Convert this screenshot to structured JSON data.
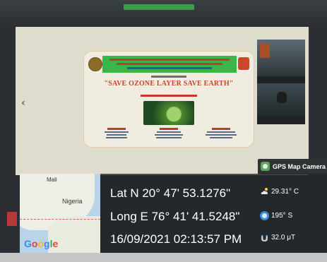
{
  "slide": {
    "title": "\"SAVE OZONE LAYER SAVE EARTH\""
  },
  "nav": {
    "prev_arrow": "‹"
  },
  "gps_badge": {
    "label": "GPS Map Camera"
  },
  "map": {
    "labels": [
      "Mali",
      "Nigeria"
    ],
    "logo": "Google"
  },
  "readout": {
    "latitude": "Lat N 20° 47' 53.1276\"",
    "longitude": "Long E 76° 41' 41.5248\"",
    "datetime": "16/09/2021 02:13:57 PM",
    "temperature": "29.31° C",
    "bearing": "195° S",
    "magnetic_field": "32.0 μT"
  },
  "icons": {
    "temperature": "cloud-icon",
    "bearing": "compass-icon",
    "magnetic_field": "magnet-icon",
    "gps": "camera-icon"
  },
  "colors": {
    "slide_header": "#39b54a",
    "slide_title": "#c7462a",
    "gps_badge": "#2f3336",
    "compass": "#3c8fd6"
  }
}
